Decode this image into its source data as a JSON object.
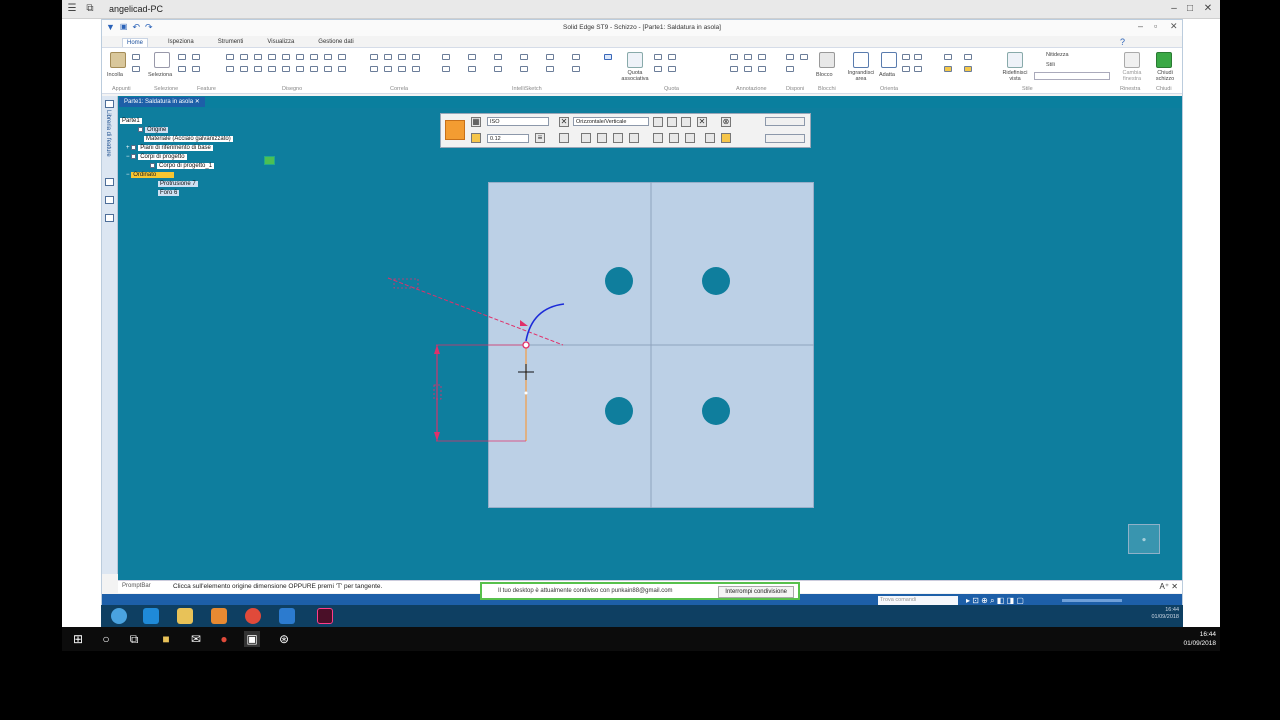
{
  "remote": {
    "host": "angelicad-PC"
  },
  "app": {
    "title": "Solid Edge ST9 - Schizzo - [Parte1: Saldatura in asola]",
    "tabs": [
      "Home",
      "Ispeziona",
      "Strumenti",
      "Visualizza",
      "Gestione dati"
    ],
    "active_tab": "Home",
    "ribbon_groups": [
      "Appunti",
      "Selezione",
      "Feature",
      "Disegno",
      "Correla",
      "IntelliSketch",
      "Quota",
      "Annotazione",
      "Disponi",
      "Blocchi",
      "Orienta",
      "Stile",
      "Rinestra",
      "Chiudi"
    ],
    "ribbon_buttons": {
      "incolla": "Incolla",
      "seleziona": "Seleziona",
      "quota_associativa": "Quota associativa",
      "blocco": "Blocco",
      "ingrandisci_area": "Ingrandisci area",
      "adatta": "Adatta",
      "ridefinisci_vista": "Ridefinisci vista",
      "cambia_finestra": "Cambia finestra",
      "chiudi_schizzo": "Chiudi schizzo"
    },
    "style_values": {
      "nitidezza": "Nitidezza",
      "stili": "Stili"
    },
    "document_tab": "Parte1: Saldatura in asola",
    "sidebar_label": "Libreria di feature"
  },
  "tree": {
    "items": [
      {
        "label": "Parte1",
        "level": 0
      },
      {
        "label": "Origine",
        "level": 1
      },
      {
        "label": "Materiale (Acciaio galvanizzato)",
        "level": 1
      },
      {
        "label": "Piani di riferimento di base",
        "level": 1
      },
      {
        "label": "Corpi di progetto",
        "level": 1
      },
      {
        "label": "Corpo di progetto_1",
        "level": 2
      },
      {
        "label": "Ordinato",
        "level": 1
      },
      {
        "label": "Protrusione 7",
        "level": 2
      },
      {
        "label": "Foro 6",
        "level": 2
      }
    ]
  },
  "sketch_toolbar": {
    "standard": "ISO",
    "value": "0.12",
    "orientation": "Orizzontale/Verticale"
  },
  "status": {
    "promptbar_label": "PromptBar",
    "message": "Clicca sull'elemento origine dimensione OPPURE premi 'T' per tangente.",
    "command_search": "Trova comandi"
  },
  "share_banner": {
    "message": "Il tuo desktop è attualmente condiviso con punkain88@gmail.com",
    "button": "Interrompi condivisione"
  },
  "clock": {
    "app_time": "16:44",
    "app_date": "01/09/2018",
    "time": "16:44",
    "date": "01/09/2018"
  },
  "colors": {
    "canvas": "#0e7e9e",
    "plate": "#bcd0e6",
    "hole": "#0f7e9d",
    "dimension": "#e0306a",
    "arc": "#1c2bd8",
    "highlight": "#f7c631"
  }
}
